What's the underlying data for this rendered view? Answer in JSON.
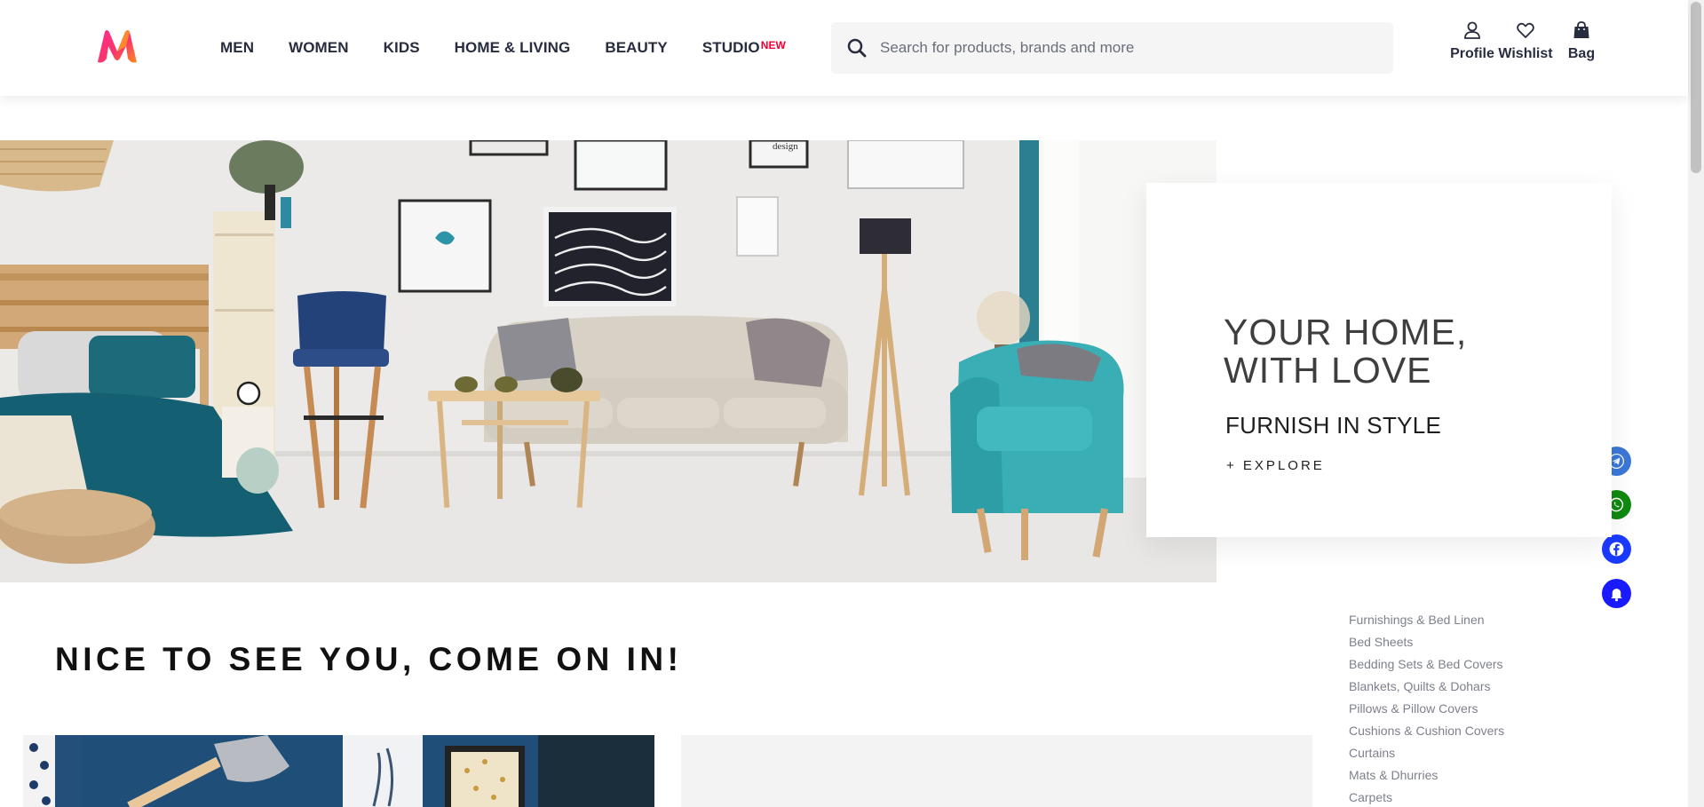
{
  "header": {
    "logo_label": "M",
    "nav": [
      {
        "label": "MEN"
      },
      {
        "label": "WOMEN"
      },
      {
        "label": "KIDS"
      },
      {
        "label": "HOME & LIVING"
      },
      {
        "label": "BEAUTY"
      },
      {
        "label": "STUDIO",
        "badge": "NEW"
      }
    ],
    "search": {
      "placeholder": "Search for products, brands and more"
    },
    "actions": {
      "profile": "Profile",
      "wishlist": "Wishlist",
      "bag": "Bag"
    }
  },
  "hero": {
    "title_line1": "YOUR HOME,",
    "title_line2": "WITH LOVE",
    "subtitle": "FURNISH IN STYLE",
    "cta": "+ EXPLORE",
    "frame_text": "design"
  },
  "welcome": {
    "title": "NICE TO SEE YOU, COME ON IN!"
  },
  "categories": [
    "Furnishings & Bed Linen",
    "Bed Sheets",
    "Bedding Sets & Bed Covers",
    "Blankets, Quilts & Dohars",
    "Pillows & Pillow Covers",
    "Cushions & Cushion Covers",
    "Curtains",
    "Mats & Dhurries",
    "Carpets"
  ],
  "social": [
    {
      "icon": "telegram-icon",
      "color": "#3b77d9"
    },
    {
      "icon": "whatsapp-icon",
      "color": "#108a10"
    },
    {
      "icon": "facebook-icon",
      "color": "#1a3aff"
    },
    {
      "icon": "bell-icon",
      "color": "#1a1aff"
    }
  ],
  "colors": {
    "accent": "#ff3f6c",
    "new_badge": "#ee0033",
    "text": "#282c3f"
  }
}
